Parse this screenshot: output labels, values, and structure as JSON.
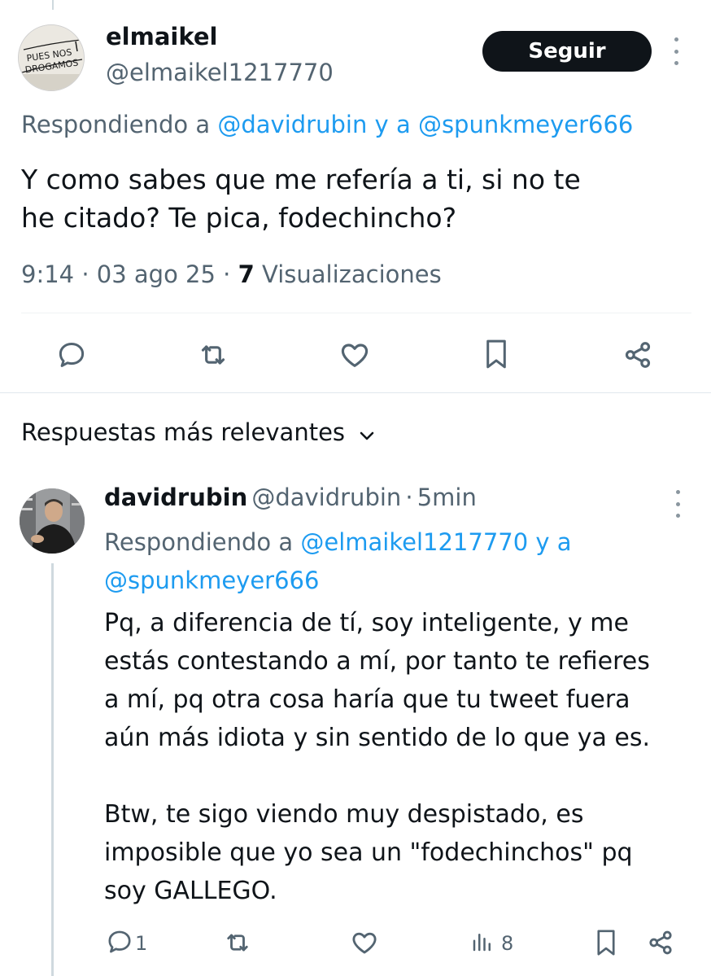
{
  "tweet": {
    "author_name": "elmaikel",
    "author_handle": "@elmaikel1217770",
    "avatar_text": "PUES NOS DROGAMOS",
    "follow_label": "Seguir",
    "replying_prefix": "Respondiendo a ",
    "replying_to_1": "@davidrubin",
    "replying_joiner": " y a ",
    "replying_to_2": "@spunkmeyer666",
    "text_line1": "Y como sabes que me refería a ti, si no te",
    "text_line2": "he citado? Te pica, fodechincho?",
    "time": "9:14",
    "date": "03 ago 25",
    "separator": "·",
    "views_count": "7",
    "views_label": "Visualizaciones",
    "actions": [
      "reply-icon",
      "retweet-icon",
      "like-icon",
      "bookmark-icon",
      "share-icon"
    ]
  },
  "replies_section": {
    "title": "Respuestas más relevantes"
  },
  "reply": {
    "author_name": "davidrubin",
    "author_handle": "@davidrubin",
    "separator": "·",
    "time_ago": "5min",
    "replying_prefix": "Respondiendo a ",
    "replying_to_1": "@elmaikel1217770",
    "replying_joiner": " y a",
    "replying_to_2": "@spunkmeyer666",
    "text_lines": [
      "Pq, a diferencia de tí, soy inteligente, y me",
      "estás contestando a mí, por tanto te refieres",
      "a mí, pq otra cosa haría que tu tweet fuera",
      "aún más idiota y sin sentido de lo que ya es.",
      "",
      "Btw, te sigo viendo muy despistado, es",
      "imposible que yo sea un \"fodechinchos\" pq",
      "soy GALLEGO."
    ],
    "reply_count": "1",
    "views_count": "8",
    "actions": [
      "reply-icon",
      "retweet-icon",
      "like-icon",
      "views-icon",
      "bookmark-icon",
      "share-icon"
    ]
  },
  "colors": {
    "text": "#0f1419",
    "secondary": "#536471",
    "link": "#1d9bf0",
    "button_bg": "#0f1419"
  }
}
